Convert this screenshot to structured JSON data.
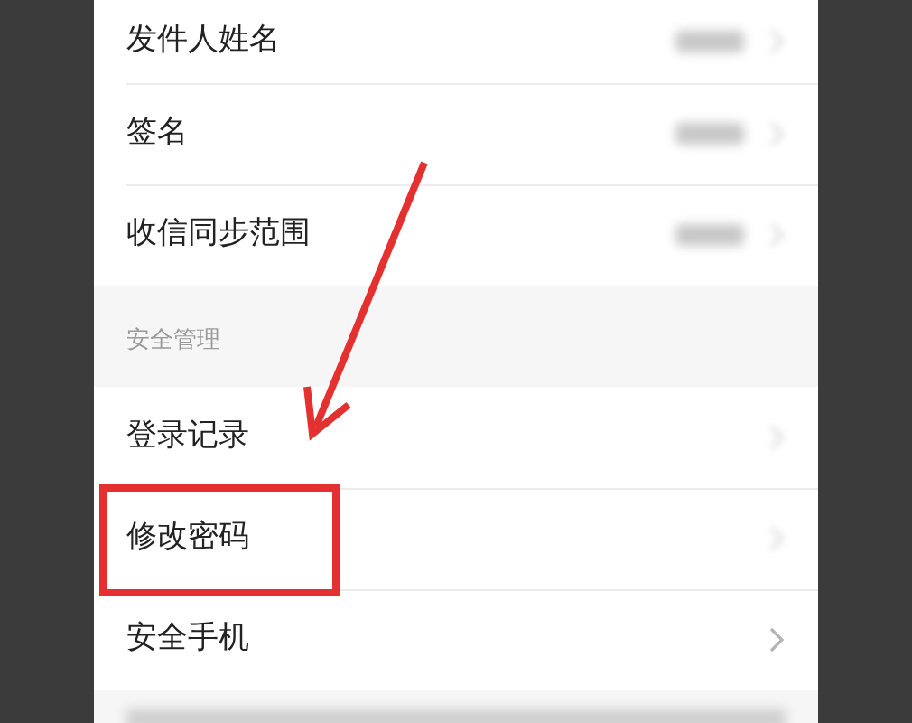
{
  "settings": [
    {
      "label": "发件人姓名",
      "has_value": true,
      "blurred": true,
      "highlighted": false
    },
    {
      "label": "签名",
      "has_value": true,
      "blurred": true,
      "highlighted": false
    },
    {
      "label": "收信同步范围",
      "has_value": true,
      "blurred": true,
      "highlighted": false
    }
  ],
  "security": {
    "header": "安全管理",
    "items": [
      {
        "label": "登录记录",
        "has_value": false,
        "blurred": true,
        "highlighted": false
      },
      {
        "label": "修改密码",
        "has_value": false,
        "blurred": true,
        "highlighted": true
      },
      {
        "label": "安全手机",
        "has_value": false,
        "blurred": false,
        "highlighted": false
      }
    ]
  },
  "footer": {
    "blurred": true
  },
  "annotations": [
    {
      "kind": "arrow"
    }
  ]
}
